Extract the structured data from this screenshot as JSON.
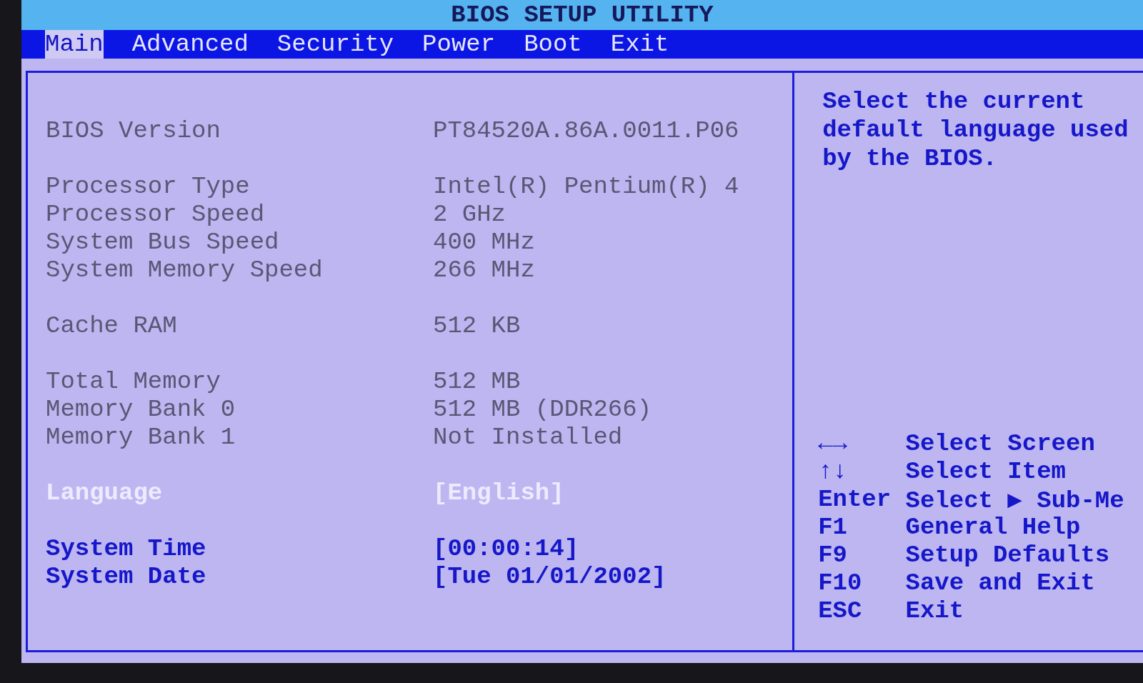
{
  "window": {
    "title": "BIOS SETUP UTILITY"
  },
  "tabs": [
    {
      "label": "Main",
      "selected": true
    },
    {
      "label": "Advanced",
      "selected": false
    },
    {
      "label": "Security",
      "selected": false
    },
    {
      "label": "Power",
      "selected": false
    },
    {
      "label": "Boot",
      "selected": false
    },
    {
      "label": "Exit",
      "selected": false
    }
  ],
  "sections": [
    {
      "items": [
        {
          "kind": "info",
          "label": "BIOS Version",
          "value": "PT84520A.86A.0011.P06"
        }
      ]
    },
    {
      "items": [
        {
          "kind": "info",
          "label": "Processor Type",
          "value": "Intel(R) Pentium(R) 4"
        },
        {
          "kind": "info",
          "label": "Processor Speed",
          "value": "2 GHz"
        },
        {
          "kind": "info",
          "label": "System Bus Speed",
          "value": "400 MHz"
        },
        {
          "kind": "info",
          "label": "System Memory Speed",
          "value": "266 MHz"
        }
      ]
    },
    {
      "items": [
        {
          "kind": "info",
          "label": "Cache RAM",
          "value": "512 KB"
        }
      ]
    },
    {
      "items": [
        {
          "kind": "info",
          "label": "Total Memory",
          "value": "512 MB"
        },
        {
          "kind": "info",
          "label": "Memory Bank 0",
          "value": "512 MB (DDR266)"
        },
        {
          "kind": "info",
          "label": "Memory Bank 1",
          "value": "Not Installed"
        }
      ]
    },
    {
      "items": [
        {
          "kind": "setting",
          "label": "Language",
          "value": "[English]",
          "selected": true
        }
      ]
    },
    {
      "items": [
        {
          "kind": "setting",
          "label": "System Time",
          "value": "[00:00:14]",
          "selected": false
        },
        {
          "kind": "setting",
          "label": "System Date",
          "value": "[Tue 01/01/2002]",
          "selected": false
        }
      ]
    }
  ],
  "help": {
    "text": "Select the current default language used by the BIOS."
  },
  "keys": [
    {
      "key": "←→",
      "action": "Select Screen"
    },
    {
      "key": "↑↓",
      "action": "Select Item"
    },
    {
      "key": "Enter",
      "action": "Select ▶ Sub-Me"
    },
    {
      "key": "F1",
      "action": "General Help"
    },
    {
      "key": "F9",
      "action": "Setup Defaults"
    },
    {
      "key": "F10",
      "action": "Save and Exit"
    },
    {
      "key": "ESC",
      "action": "Exit"
    }
  ]
}
